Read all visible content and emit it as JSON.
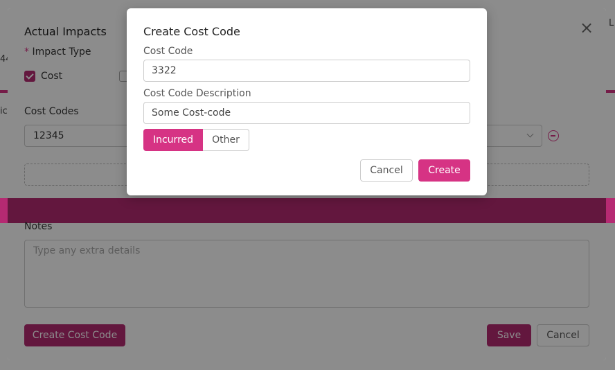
{
  "background_page": {
    "edge_texts": [
      "44",
      "ic",
      "L"
    ]
  },
  "outer_modal": {
    "title": "Actual Impacts",
    "impact_type": {
      "required_mark": "*",
      "label": "Impact Type",
      "options": [
        {
          "label": "Cost",
          "checked": true
        },
        {
          "label": "",
          "checked": false
        }
      ]
    },
    "cost_codes": {
      "label": "Cost Codes",
      "value": "12345"
    },
    "notes": {
      "label": "Notes",
      "placeholder": "Type any extra details"
    },
    "buttons": {
      "create_cost_code": "Create Cost Code",
      "save": "Save",
      "cancel": "Cancel"
    }
  },
  "create_modal": {
    "title": "Create Cost Code",
    "cost_code": {
      "label": "Cost Code",
      "value": "3322"
    },
    "description": {
      "label": "Cost Code Description",
      "value": "Some Cost-code"
    },
    "type_toggle": {
      "options": [
        "Incurred",
        "Other"
      ],
      "selected": "Incurred"
    },
    "buttons": {
      "cancel": "Cancel",
      "create": "Create"
    }
  },
  "colors": {
    "accent": "#d63384",
    "accent_dark": "#b52a72"
  }
}
